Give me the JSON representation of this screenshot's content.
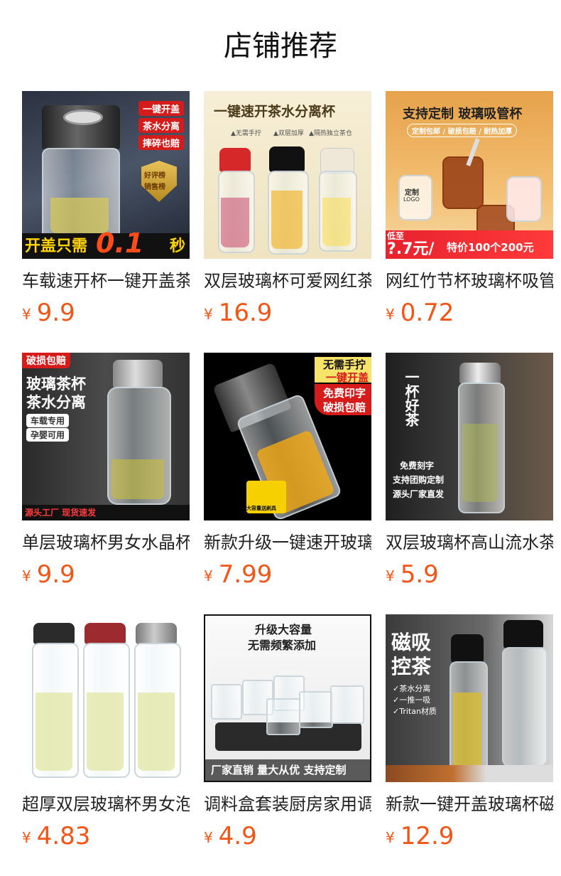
{
  "page": {
    "title": "店铺推荐"
  },
  "currency": "¥",
  "products": [
    {
      "name": "车载速开杯一键开盖茶水分离",
      "price": "9.9",
      "captions": [
        "一键开盖",
        "茶水分离",
        "摔碎也赔",
        "好评榜",
        "销售榜",
        "开盖只需",
        "0.1",
        "秒"
      ]
    },
    {
      "name": "双层玻璃杯可爱网红茶水分离",
      "price": "16.9",
      "captions": [
        "一键速开茶水分离杯",
        "▲无需手拧",
        "▲双层加厚",
        "▲隔热独立茶仓"
      ]
    },
    {
      "name": "网红竹节杯玻璃杯吸管杯",
      "price": "0.72",
      "captions": [
        "支持定制 玻璃吸管杯",
        "定制包邮 / 破损包赔 / 耐热加厚",
        "低至",
        "?.7元/",
        "特价100个200元",
        "定制",
        "LOGO"
      ]
    },
    {
      "name": "单层玻璃杯男女水晶杯",
      "price": "9.9",
      "captions": [
        "破损包赔",
        "玻璃茶杯",
        "茶水分离",
        "车载专用",
        "孕婴可用",
        "源头工厂 现货速发"
      ]
    },
    {
      "name": "新款升级一键速开玻璃杯",
      "price": "7.99",
      "captions": [
        "无需手拧",
        "一键开盖",
        "免费印字",
        "破损包赔",
        "大容量送刷具"
      ]
    },
    {
      "name": "双层玻璃杯高山流水茶杯",
      "price": "5.9",
      "captions": [
        "一杯好茶",
        "免费刻字",
        "支持团购定制",
        "源头厂家直发"
      ]
    },
    {
      "name": "超厚双层玻璃杯男女泡茶杯",
      "price": "4.83",
      "captions": []
    },
    {
      "name": "调料盒套装厨房家用调味罐",
      "price": "4.9",
      "captions": [
        "升级大容量",
        "无需频繁添加",
        "厂家直销 量大从优 支持定制"
      ]
    },
    {
      "name": "新款一键开盖玻璃杯磁吸",
      "price": "12.9",
      "captions": [
        "磁吸",
        "控茶",
        "✓茶水分离",
        "✓一推一吸",
        "✓Tritan材质"
      ]
    }
  ]
}
